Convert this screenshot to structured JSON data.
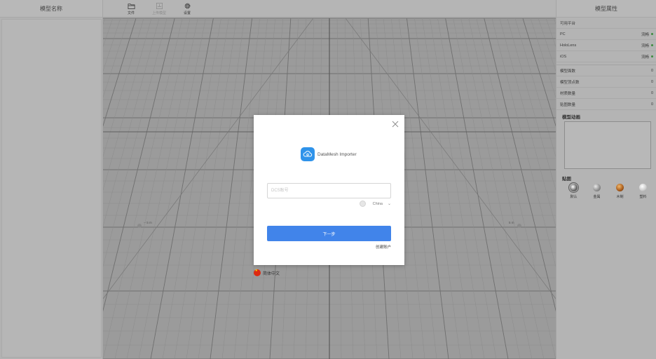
{
  "left_panel": {
    "header": "模型名称"
  },
  "toolbar": {
    "file_label": "文件",
    "upload_label": "上传模型",
    "settings_label": "设置"
  },
  "viewport": {
    "scale_left": "-- 5 m",
    "scale_right": "5 m"
  },
  "right_panel": {
    "header": "模型属性",
    "platforms_title": "可用平台",
    "platforms": [
      {
        "name": "PC",
        "status": "流畅"
      },
      {
        "name": "HoloLens",
        "status": "流畅"
      },
      {
        "name": "iOS",
        "status": "流畅"
      }
    ],
    "status_color": "#3e8a3e",
    "stats": [
      {
        "label": "模型面数",
        "value": "0"
      },
      {
        "label": "模型顶点数",
        "value": "0"
      },
      {
        "label": "材质数量",
        "value": "0"
      },
      {
        "label": "贴图数量",
        "value": "0"
      }
    ],
    "animation_title": "模型动画",
    "textures_title": "贴图",
    "textures": [
      {
        "label": "默认",
        "icon": "default-ball-icon"
      },
      {
        "label": "金属",
        "icon": "metal-icon"
      },
      {
        "label": "木制",
        "icon": "wood-ball-icon"
      },
      {
        "label": "塑料",
        "icon": "plastic-ball-icon"
      }
    ]
  },
  "modal": {
    "app_name": "DataMesh Importer",
    "account_placeholder": "DCS账号",
    "region": "China",
    "next_label": "下一步",
    "create_account_label": "创建账户",
    "accent_color": "#4184ea"
  },
  "language": {
    "label": "简体中文"
  }
}
